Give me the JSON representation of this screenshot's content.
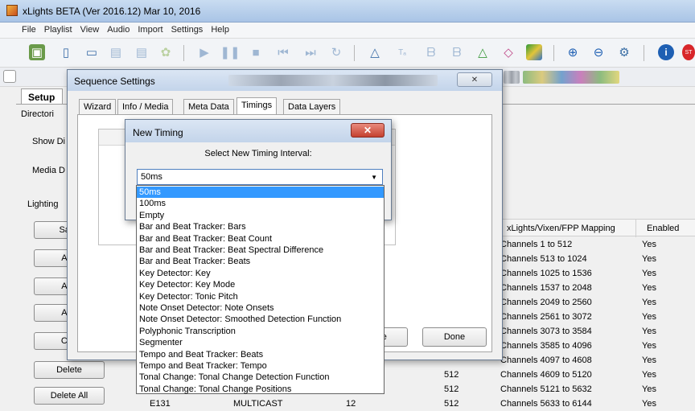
{
  "window": {
    "title": "xLights BETA (Ver 2016.12) Mar 10, 2016"
  },
  "menu": [
    "File",
    "Playlist",
    "View",
    "Audio",
    "Import",
    "Settings",
    "Help"
  ],
  "setup": {
    "tab_label": "Setup",
    "directories_label": "Directori",
    "show_dir_label": "Show Di",
    "media_dir_label": "Media D",
    "lighting_label": "Lighting",
    "buttons": [
      "Save",
      "Add",
      "Add",
      "Add",
      "Cha",
      "Delete",
      "Delete All"
    ]
  },
  "grid": {
    "headers": {
      "mapping": "xLights/Vixen/FPP Mapping",
      "enabled": "Enabled"
    },
    "rows": [
      {
        "mapping": "Channels 1 to 512",
        "enabled": "Yes"
      },
      {
        "mapping": "Channels 513 to 1024",
        "enabled": "Yes"
      },
      {
        "mapping": "Channels 1025 to 1536",
        "enabled": "Yes"
      },
      {
        "mapping": "Channels 1537 to 2048",
        "enabled": "Yes"
      },
      {
        "mapping": "Channels 2049 to 2560",
        "enabled": "Yes"
      },
      {
        "mapping": "Channels 2561 to 3072",
        "enabled": "Yes"
      },
      {
        "mapping": "Channels 3073 to 3584",
        "enabled": "Yes"
      },
      {
        "mapping": "Channels 3585 to 4096",
        "enabled": "Yes"
      },
      {
        "mapping": "Channels 4097 to 4608",
        "enabled": "Yes"
      },
      {
        "count": "512",
        "mapping": "Channels 4609 to 5120",
        "enabled": "Yes"
      },
      {
        "count": "512",
        "mapping": "Channels 5121 to 5632",
        "enabled": "Yes"
      },
      {
        "type": "E131",
        "mode": "MULTICAST",
        "universe": "12",
        "count": "512",
        "mapping": "Channels 5633 to 6144",
        "enabled": "Yes"
      }
    ]
  },
  "sequence_settings": {
    "title": "Sequence Settings",
    "tabs": [
      "Wizard",
      "Info / Media",
      "Meta Data",
      "Timings",
      "Data Layers"
    ],
    "active_tab": "Timings",
    "cancel_label": "nce",
    "done_label": "Done"
  },
  "new_timing": {
    "title": "New Timing",
    "close_label": "✕",
    "prompt": "Select New Timing Interval:",
    "selected": "50ms",
    "options": [
      "50ms",
      "100ms",
      "Empty",
      "Bar and Beat Tracker: Bars",
      "Bar and Beat Tracker: Beat Count",
      "Bar and Beat Tracker: Beat Spectral Difference",
      "Bar and Beat Tracker: Beats",
      "Key Detector: Key",
      "Key Detector: Key Mode",
      "Key Detector: Tonic Pitch",
      "Note Onset Detector: Note Onsets",
      "Note Onset Detector: Smoothed Detection Function",
      "Polyphonic Transcription",
      "Segmenter",
      "Tempo and Beat Tracker: Beats",
      "Tempo and Beat Tracker: Tempo",
      "Tonal Change: Tonal Change Detection Function",
      "Tonal Change: Tonal Change Positions"
    ]
  },
  "colors": {
    "selection": "#3399ff",
    "title_bar": "#c3d4ea",
    "close_button": "#c4402f",
    "stop_red": "#d8262a",
    "info_blue": "#1e5fb3"
  },
  "toolbar_icons": [
    "new-sequence-icon",
    "new-file-icon",
    "open-icon",
    "save-icon",
    "save-as-icon",
    "render-icon",
    "play-icon",
    "pause-icon",
    "stop-icon",
    "rewind-icon",
    "forward-icon",
    "replay-icon",
    "ramp-icon",
    "text-icon",
    "bars-icon",
    "bars-alt-icon",
    "triangle-icon",
    "diamond-icon",
    "grid-color-icon",
    "zoom-in-icon",
    "zoom-out-icon",
    "settings-gear-icon",
    "info-icon",
    "stop-sign-icon"
  ]
}
